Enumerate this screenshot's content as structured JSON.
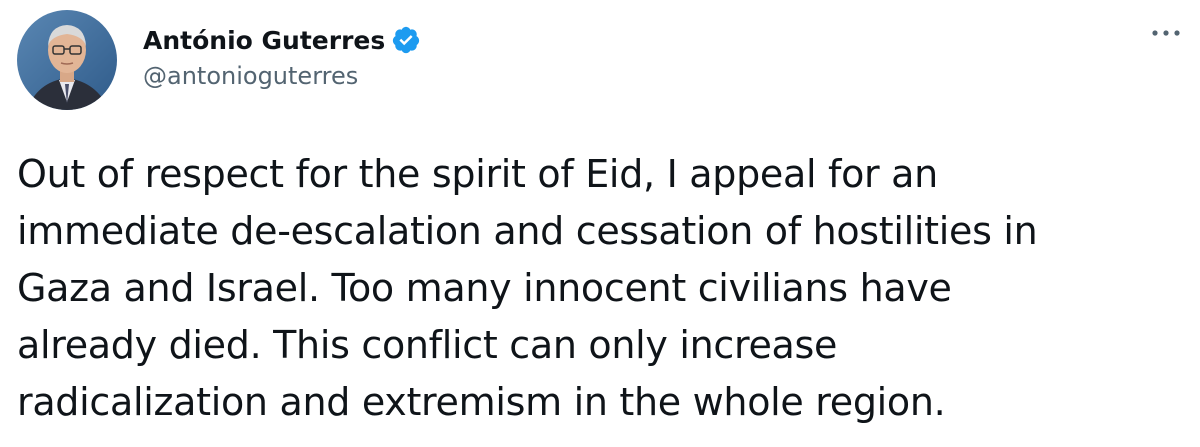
{
  "author": {
    "display_name": "António Guterres",
    "handle": "@antonioguterres",
    "verified": true,
    "avatar_icon": "avatar-portrait"
  },
  "menu": {
    "icon": "more-options-icon"
  },
  "tweet": {
    "text": "Out of respect for the spirit of Eid, I appeal for an\nimmediate de-escalation and cessation of hostilities in\nGaza and Israel. Too many innocent civilians have\nalready died. This conflict can only increase\nradicalization and extremism in the whole region."
  },
  "colors": {
    "verified_blue": "#1d9bf0",
    "handle_gray": "#536471",
    "text": "#0f1419"
  }
}
